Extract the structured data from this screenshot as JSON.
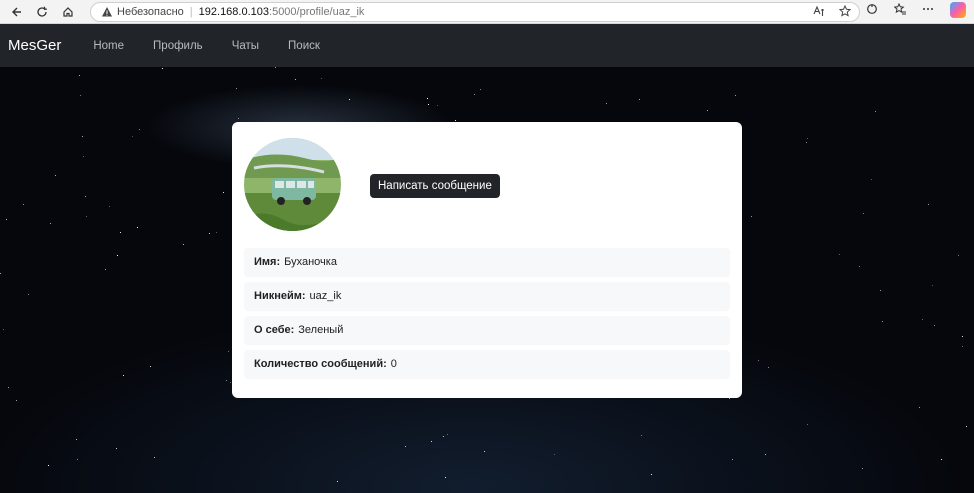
{
  "browser": {
    "security_label": "Небезопасно",
    "url_host": "192.168.0.103",
    "url_rest": ":5000/profile/uaz_ik"
  },
  "navbar": {
    "brand": "MesGer",
    "links": [
      "Home",
      "Профиль",
      "Чаты",
      "Поиск"
    ]
  },
  "profile": {
    "message_button": "Написать сообщение",
    "fields": [
      {
        "label": "Имя:",
        "value": "Буханочка"
      },
      {
        "label": "Никнейм:",
        "value": "uaz_ik"
      },
      {
        "label": "О себе:",
        "value": "Зеленый"
      },
      {
        "label": "Количество сообщений:",
        "value": "0"
      }
    ]
  }
}
